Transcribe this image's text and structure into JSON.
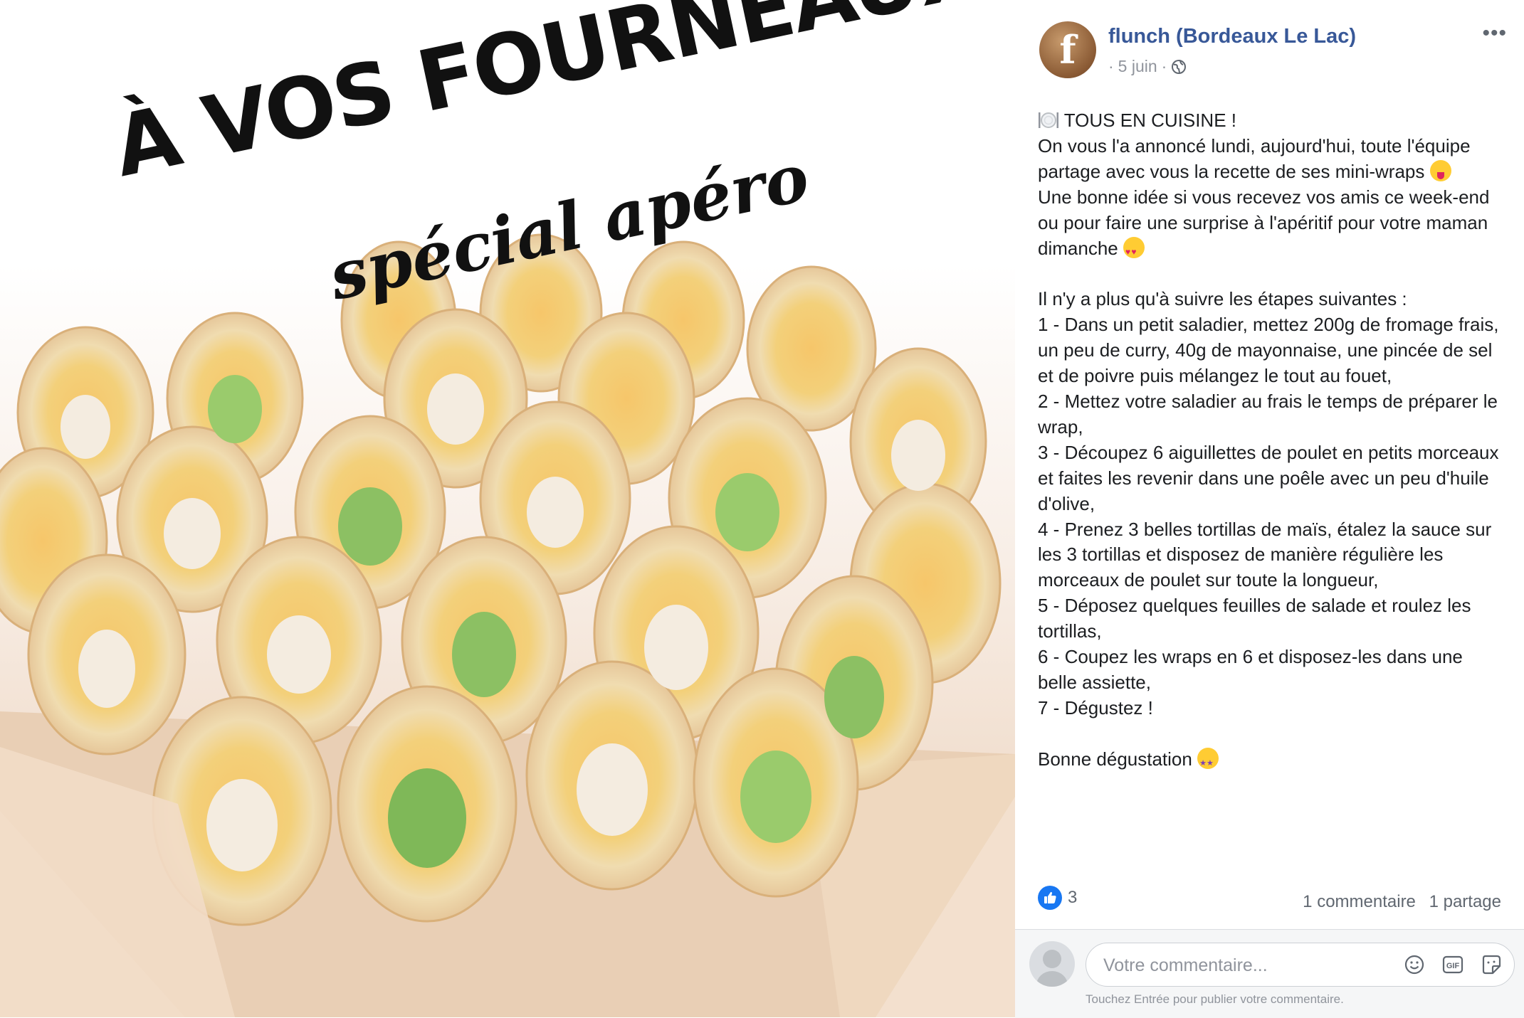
{
  "image": {
    "headline": "À VOS FOURNEAUX",
    "subline": "spécial apéro"
  },
  "post": {
    "page_name": "flunch (Bordeaux Le Lac)",
    "avatar_letter": "f",
    "date": "5 juin",
    "separator": "·",
    "privacy_icon": "globe-icon",
    "more_label": "•••",
    "lines": {
      "l1": "TOUS EN CUISINE !",
      "l2": "On vous l'a annoncé lundi, aujourd'hui, toute l'équipe partage avec vous la recette de ses mini-wraps",
      "l3": "Une bonne idée si vous recevez vos amis ce week-end ou pour faire une surprise à l'apéritif pour votre maman dimanche",
      "l4": "Il n'y a plus qu'à suivre les étapes suivantes :",
      "s1": "1 - Dans un petit saladier, mettez 200g de fromage frais, un peu de curry, 40g de mayonnaise, une pincée de sel et de poivre puis mélangez le tout au fouet,",
      "s2": "2 - Mettez votre saladier au frais le temps de préparer le wrap,",
      "s3": "3 - Découpez 6 aiguillettes de poulet en petits morceaux et faites les revenir dans une poêle avec un peu d'huile d'olive,",
      "s4": "4 - Prenez 3 belles tortillas de maïs, étalez la sauce sur les 3 tortillas et disposez de manière régulière les morceaux de poulet sur toute la longueur,",
      "s5": "5 - Déposez quelques feuilles de salade et roulez les tortillas,",
      "s6": "6 - Coupez les wraps en 6 et disposez-les dans une belle assiette,",
      "s7": "7 - Dégustez !",
      "closing": "Bonne dégustation"
    },
    "reaction_count": "3",
    "comments_label": "1 commentaire",
    "shares_label": "1 partage"
  },
  "composer": {
    "placeholder": "Votre commentaire...",
    "hint": "Touchez Entrée pour publier votre commentaire.",
    "icons": [
      "emoji-icon",
      "gif-icon",
      "sticker-icon"
    ]
  },
  "colors": {
    "link": "#385898",
    "like": "#1877f2",
    "muted": "#90949c"
  }
}
